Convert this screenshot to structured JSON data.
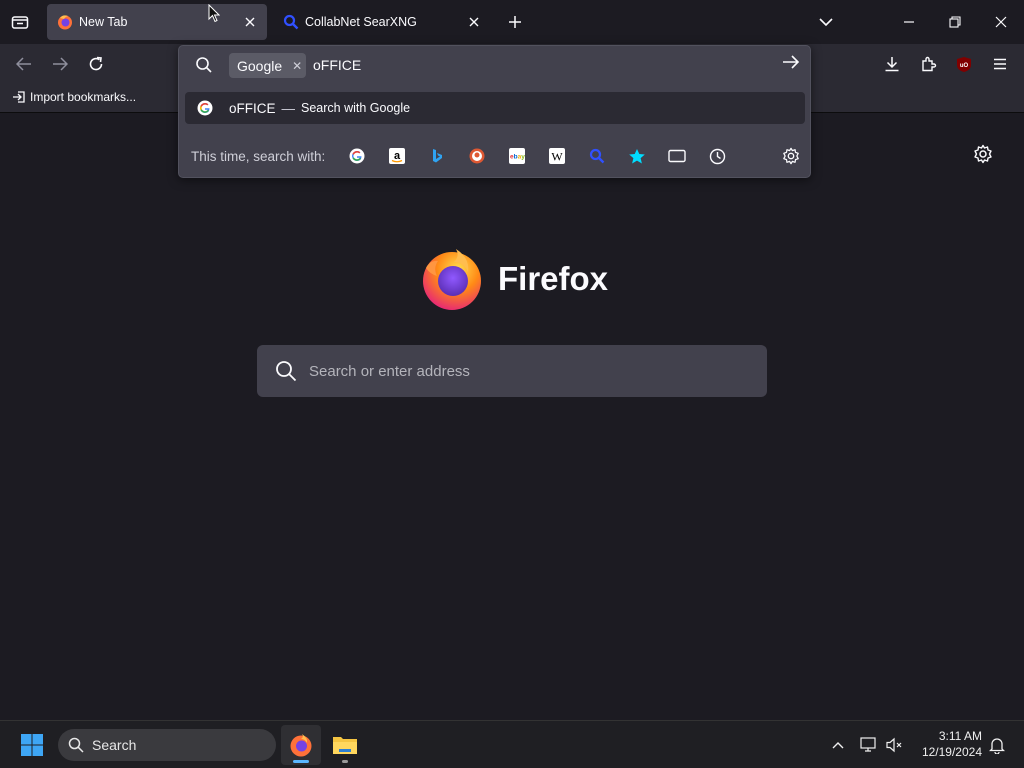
{
  "tabs": [
    {
      "title": "New Tab",
      "active": true
    },
    {
      "title": "CollabNet SearXNG",
      "active": false
    }
  ],
  "bookmarks": {
    "import_label": "Import bookmarks..."
  },
  "urlbar": {
    "engine_chip": "Google",
    "typed_text": "oFFICE",
    "result": {
      "query": "oFFICE",
      "separator": "—",
      "action": "Search with Google"
    },
    "one_off_label": "This time, search with:",
    "one_off_engines": [
      "Google",
      "Amazon",
      "Bing",
      "DuckDuckGo",
      "eBay",
      "Wikipedia",
      "CollabNet SearXNG",
      "Bookmarks",
      "Tabs",
      "History"
    ]
  },
  "newtab": {
    "wordmark": "Firefox",
    "search_placeholder": "Search or enter address"
  },
  "taskbar": {
    "search_label": "Search",
    "time": "3:11 AM",
    "date": "12/19/2024"
  },
  "colors": {
    "chrome_bg": "#1c1b22",
    "toolbar_bg": "#2b2a33",
    "field_bg": "#42414d",
    "accent_blue": "#5bb6ff"
  }
}
